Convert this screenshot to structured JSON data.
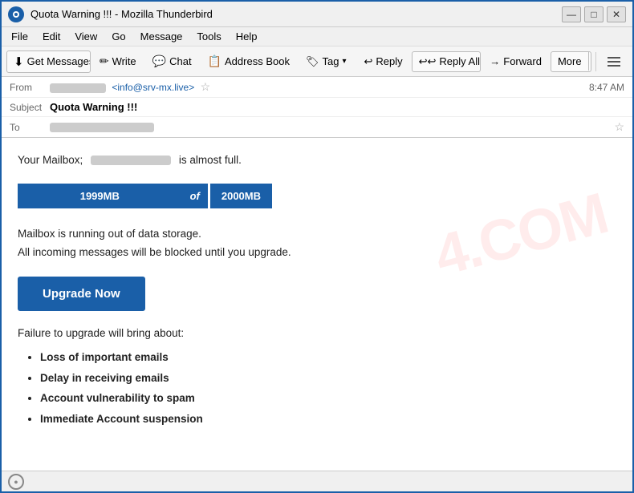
{
  "window": {
    "title": "Quota Warning !!! - Mozilla Thunderbird",
    "icon_label": "T"
  },
  "titlebar": {
    "minimize_label": "—",
    "maximize_label": "□",
    "close_label": "✕"
  },
  "menubar": {
    "items": [
      "File",
      "Edit",
      "View",
      "Go",
      "Message",
      "Tools",
      "Help"
    ]
  },
  "toolbar": {
    "get_messages_label": "Get Messages",
    "write_label": "Write",
    "chat_label": "Chat",
    "address_book_label": "Address Book",
    "tag_label": "Tag",
    "reply_label": "Reply",
    "reply_all_label": "Reply All",
    "forward_label": "Forward",
    "more_label": "More"
  },
  "email": {
    "from_label": "From",
    "from_address": "<info@srv-mx.live>",
    "subject_label": "Subject",
    "subject": "Quota Warning !!!",
    "to_label": "To",
    "time": "8:47 AM",
    "body": {
      "intro": "Your Mailbox;",
      "intro_suffix": "is almost full.",
      "quota_used": "1999MB",
      "quota_of": "of",
      "quota_total": "2000MB",
      "warning_line1": "Mailbox is running out of data storage.",
      "warning_line2": "All incoming messages will be blocked until you upgrade.",
      "upgrade_button": "Upgrade Now",
      "failure_intro": "Failure to upgrade will bring about:",
      "consequences": [
        "Loss of important emails",
        "Delay in receiving emails",
        "Account vulnerability to spam",
        "Immediate Account suspension"
      ]
    }
  },
  "statusbar": {
    "icon_label": "(•)"
  }
}
